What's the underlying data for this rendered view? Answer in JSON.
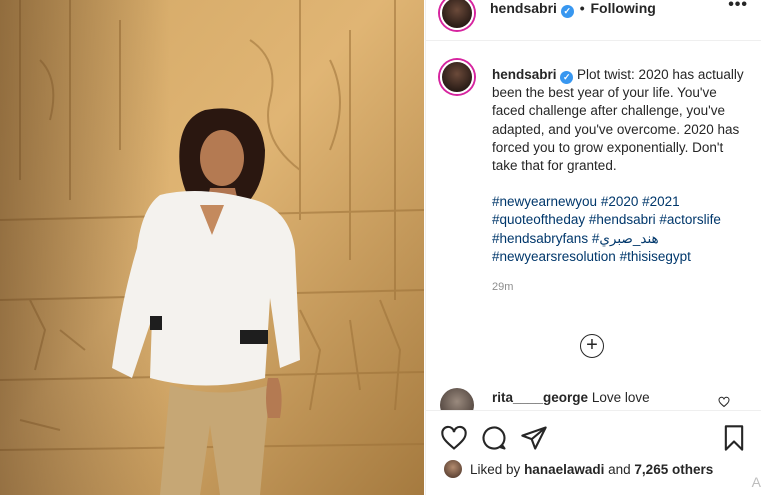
{
  "post": {
    "username": "hendsabri",
    "verified_mark": "✓",
    "separator": "•",
    "follow_status": "Following",
    "more_label": "•••"
  },
  "caption": {
    "username": "hendsabri",
    "text": "Plot twist: 2020 has actually been the best year of your life. You've faced challenge after challenge, you've adapted, and you've overcome. 2020 has forced you to grow exponentially. Don't take that for granted.",
    "hashtags": "#newyearnewyou #2020 #2021 #quoteoftheday #hendsabri #actorslife #hendsabryfans #هند_صبري #newyearsresolution #thisisegypt",
    "time_ago": "29m"
  },
  "load_more_label": "+",
  "comment": {
    "username": "rita____george",
    "text": "Love love"
  },
  "likes": {
    "prefix": "Liked by",
    "user": "hanaelawadi",
    "middle": "and",
    "count": "7,265 others"
  },
  "scroll_letter": "A",
  "icons": {
    "like": "heart-icon",
    "comment": "comment-icon",
    "share": "share-icon",
    "save": "bookmark-icon"
  },
  "colors": {
    "hashtag": "#00376b",
    "verified": "#3897f0",
    "story_ring": "#d6249f"
  }
}
